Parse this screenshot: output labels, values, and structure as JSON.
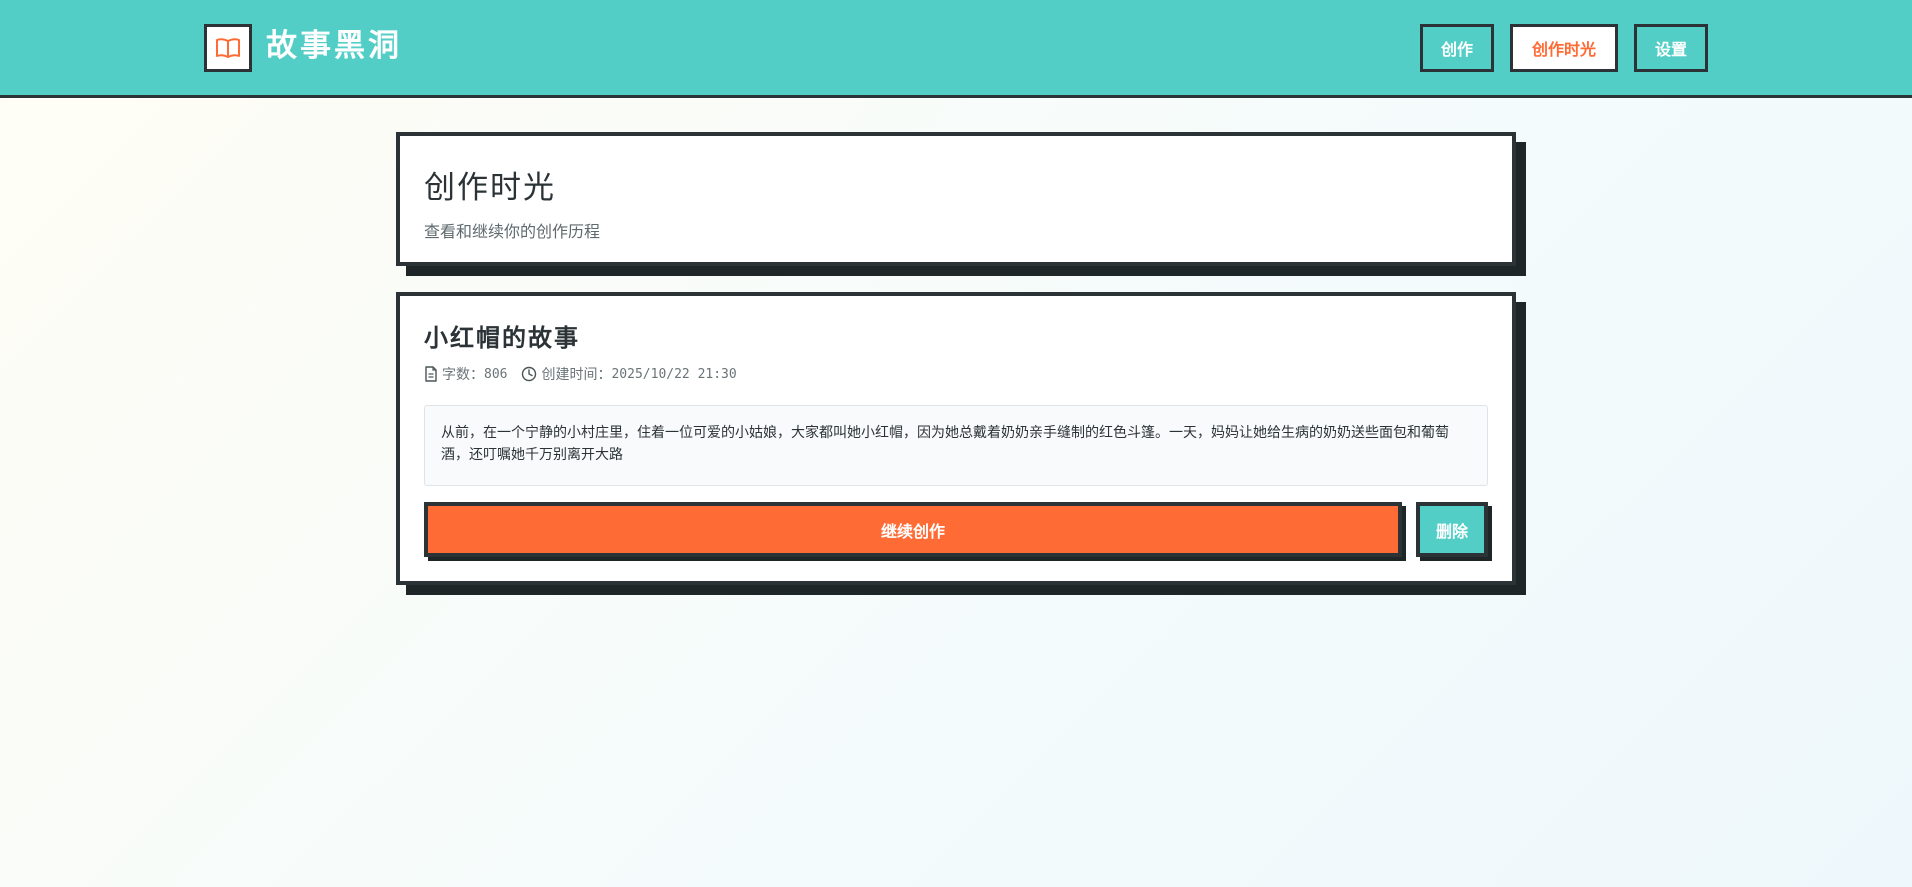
{
  "header": {
    "app_title": "故事黑洞",
    "logo_icon": "open-book-icon",
    "nav": {
      "create": "创作",
      "history": "创作时光",
      "settings": "设置"
    }
  },
  "page": {
    "title": "创作时光",
    "subtitle": "查看和继续你的创作历程"
  },
  "story": {
    "title": "小红帽的故事",
    "word_count_label": "字数：",
    "word_count": "806",
    "created_label": "创建时间：",
    "created_at": "2025/10/22 21:30",
    "excerpt": "从前，在一个宁静的小村庄里，住着一位可爱的小姑娘，大家都叫她小红帽，因为她总戴着奶奶亲手缝制的红色斗篷。一天，妈妈让她给生病的奶奶送些面包和葡萄酒，还叮嘱她千万别离开大路",
    "continue_label": "继续创作",
    "delete_label": "删除"
  },
  "colors": {
    "primary": "#52cec7",
    "accent": "#ff6b35",
    "ink": "#2b3336"
  }
}
